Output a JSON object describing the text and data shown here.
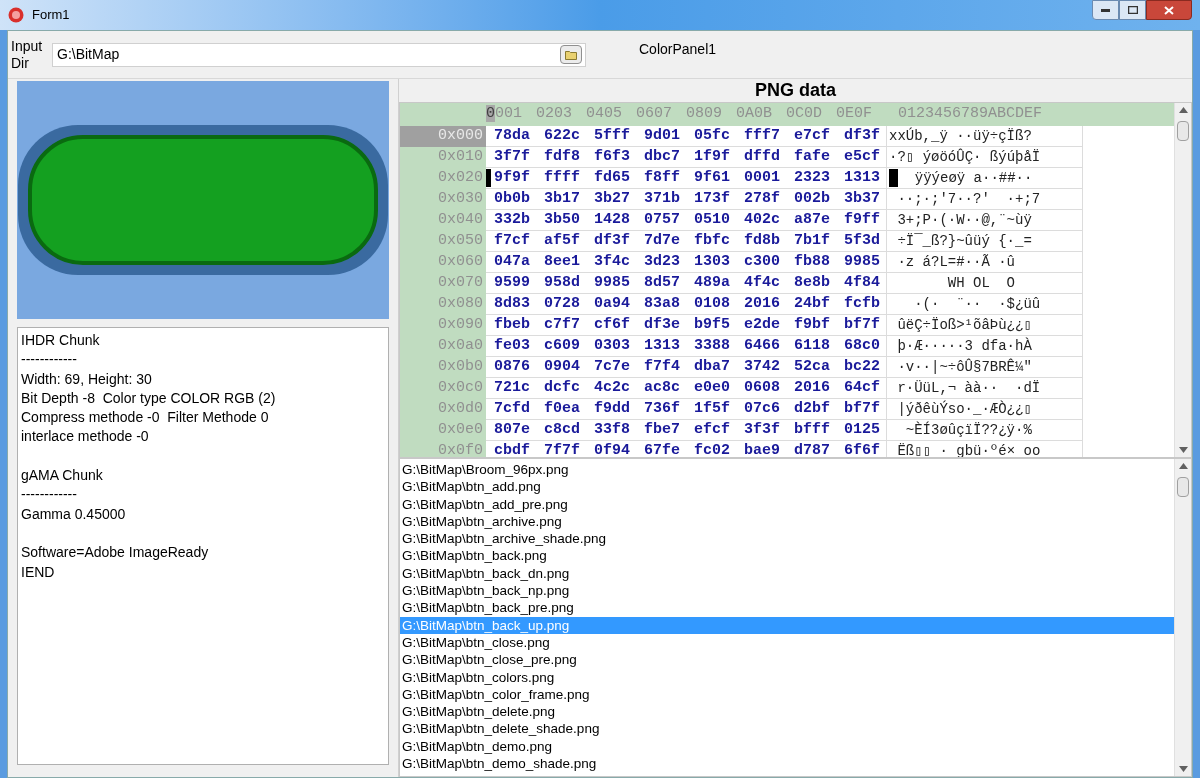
{
  "window": {
    "title": "Form1"
  },
  "input_dir": {
    "label": "Input Dir",
    "value": "G:\\BitMap"
  },
  "color_panel": {
    "label": "ColorPanel1"
  },
  "info_text": [
    [
      "IHDR Chunk",
      "------------",
      "Width: 69, Height: 30",
      "Bit Depth -8  Color type COLOR RGB (2)",
      "Compress methode -0  Filter Methode 0",
      "interlace methode -0"
    ],
    [
      "gAMA Chunk",
      "------------",
      "Gamma 0.45000"
    ],
    [
      "Software=Adobe ImageReady",
      "IEND"
    ]
  ],
  "hex_view": {
    "title": "PNG data",
    "header": {
      "columns": [
        {
          "label": "0001",
          "selected": true
        },
        {
          "label": "0203",
          "selected": false
        },
        {
          "label": "0405",
          "selected": false
        },
        {
          "label": "0607",
          "selected": false
        },
        {
          "label": "0809",
          "selected": false
        },
        {
          "label": "0A0B",
          "selected": false
        },
        {
          "label": "0C0D",
          "selected": false
        },
        {
          "label": "0E0F",
          "selected": false
        }
      ],
      "ascii": "0123456789ABCDEF"
    },
    "rows": [
      {
        "offset": "0x000",
        "selected": true,
        "cursor": false,
        "words": [
          "78da",
          "622c",
          "5fff",
          "9d01",
          "05fc",
          "fff7",
          "e7cf",
          "df3f"
        ],
        "ascii": "xxÚb,_ÿ ··üÿ÷çÏß?"
      },
      {
        "offset": "0x010",
        "selected": false,
        "cursor": false,
        "words": [
          "3f7f",
          "fdf8",
          "f6f3",
          "dbc7",
          "1f9f",
          "dffd",
          "fafe",
          "e5cf"
        ],
        "ascii": "·?▯ ýøöóÛÇ· ßýúþåÏ"
      },
      {
        "offset": "0x020",
        "selected": false,
        "cursor": true,
        "words": [
          "9f9f",
          "ffff",
          "fd65",
          "f8ff",
          "9f61",
          "0001",
          "2323",
          "1313"
        ],
        "ascii": "  ÿÿýeøÿ a··##··"
      },
      {
        "offset": "0x030",
        "selected": false,
        "cursor": false,
        "words": [
          "0b0b",
          "3b17",
          "3b27",
          "371b",
          "173f",
          "278f",
          "002b",
          "3b37"
        ],
        "ascii": " ··;·;'7··?'  ·+;7"
      },
      {
        "offset": "0x040",
        "selected": false,
        "cursor": false,
        "words": [
          "332b",
          "3b50",
          "1428",
          "0757",
          "0510",
          "402c",
          "a87e",
          "f9ff"
        ],
        "ascii": " 3+;P·(·W··@,¨~ùÿ"
      },
      {
        "offset": "0x050",
        "selected": false,
        "cursor": false,
        "words": [
          "f7cf",
          "af5f",
          "df3f",
          "7d7e",
          "fbfc",
          "fd8b",
          "7b1f",
          "5f3d"
        ],
        "ascii": " ÷Ï¯_ß?}~ûüý {·_="
      },
      {
        "offset": "0x060",
        "selected": false,
        "cursor": false,
        "words": [
          "047a",
          "8ee1",
          "3f4c",
          "3d23",
          "1303",
          "c300",
          "fb88",
          "9985"
        ],
        "ascii": " ·z á?L=#··Ã ·û"
      },
      {
        "offset": "0x070",
        "selected": false,
        "cursor": false,
        "words": [
          "9599",
          "958d",
          "9985",
          "8d57",
          "489a",
          "4f4c",
          "8e8b",
          "4f84"
        ],
        "ascii": "       WH OL  O"
      },
      {
        "offset": "0x080",
        "selected": false,
        "cursor": false,
        "words": [
          "8d83",
          "0728",
          "0a94",
          "83a8",
          "0108",
          "2016",
          "24bf",
          "fcfb"
        ],
        "ascii": "   ·(·  ¨··  ·$¿üû"
      },
      {
        "offset": "0x090",
        "selected": false,
        "cursor": false,
        "words": [
          "fbeb",
          "c7f7",
          "cf6f",
          "df3e",
          "b9f5",
          "e2de",
          "f9bf",
          "bf7f"
        ],
        "ascii": " ûëÇ÷Ïoß>¹õâÞù¿¿▯"
      },
      {
        "offset": "0x0a0",
        "selected": false,
        "cursor": false,
        "words": [
          "fe03",
          "c609",
          "0303",
          "1313",
          "3388",
          "6466",
          "6118",
          "68c0"
        ],
        "ascii": " þ·Æ·····3 dfa·hÀ"
      },
      {
        "offset": "0x0b0",
        "selected": false,
        "cursor": false,
        "words": [
          "0876",
          "0904",
          "7c7e",
          "f7f4",
          "dba7",
          "3742",
          "52ca",
          "bc22"
        ],
        "ascii": " ·v··|~÷ôÛ§7BRÊ¼\""
      },
      {
        "offset": "0x0c0",
        "selected": false,
        "cursor": false,
        "words": [
          "721c",
          "dcfc",
          "4c2c",
          "ac8c",
          "e0e0",
          "0608",
          "2016",
          "64cf"
        ],
        "ascii": " r·ÜüL,¬ àà··  ·dÏ"
      },
      {
        "offset": "0x0d0",
        "selected": false,
        "cursor": false,
        "words": [
          "7cfd",
          "f0ea",
          "f9dd",
          "736f",
          "1f5f",
          "07c6",
          "d2bf",
          "bf7f"
        ],
        "ascii": " |ýðêùÝso·_·ÆÒ¿¿▯"
      },
      {
        "offset": "0x0e0",
        "selected": false,
        "cursor": false,
        "words": [
          "807e",
          "c8cd",
          "33f8",
          "fbe7",
          "efcf",
          "3f3f",
          "bfff",
          "0125"
        ],
        "ascii": "  ~ÈÍ3øûçïÏ??¿ÿ·%"
      },
      {
        "offset": "0x0f0",
        "selected": false,
        "cursor": false,
        "words": [
          "cbdf",
          "7f7f",
          "0f94",
          "67fe",
          "fc02",
          "bae9",
          "d787",
          "6f6f"
        ],
        "ascii": " Ëß▯▯ · gbü·ºé× oo"
      }
    ]
  },
  "files": [
    {
      "path": "G:\\BitMap\\Broom_96px.png",
      "selected": false
    },
    {
      "path": "G:\\BitMap\\btn_add.png",
      "selected": false
    },
    {
      "path": "G:\\BitMap\\btn_add_pre.png",
      "selected": false
    },
    {
      "path": "G:\\BitMap\\btn_archive.png",
      "selected": false
    },
    {
      "path": "G:\\BitMap\\btn_archive_shade.png",
      "selected": false
    },
    {
      "path": "G:\\BitMap\\btn_back.png",
      "selected": false
    },
    {
      "path": "G:\\BitMap\\btn_back_dn.png",
      "selected": false
    },
    {
      "path": "G:\\BitMap\\btn_back_np.png",
      "selected": false
    },
    {
      "path": "G:\\BitMap\\btn_back_pre.png",
      "selected": false
    },
    {
      "path": "G:\\BitMap\\btn_back_up.png",
      "selected": true
    },
    {
      "path": "G:\\BitMap\\btn_close.png",
      "selected": false
    },
    {
      "path": "G:\\BitMap\\btn_close_pre.png",
      "selected": false
    },
    {
      "path": "G:\\BitMap\\btn_colors.png",
      "selected": false
    },
    {
      "path": "G:\\BitMap\\btn_color_frame.png",
      "selected": false
    },
    {
      "path": "G:\\BitMap\\btn_delete.png",
      "selected": false
    },
    {
      "path": "G:\\BitMap\\btn_delete_shade.png",
      "selected": false
    },
    {
      "path": "G:\\BitMap\\btn_demo.png",
      "selected": false
    },
    {
      "path": "G:\\BitMap\\btn_demo_shade.png",
      "selected": false
    }
  ]
}
